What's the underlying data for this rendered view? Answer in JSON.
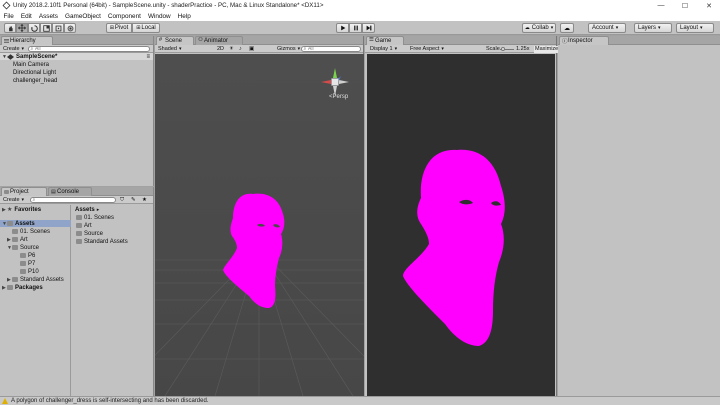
{
  "window": {
    "title": "Unity 2018.2.10f1 Personal (64bit) - SampleScene.unity - shaderPractice - PC, Mac & Linux Standalone* <DX11>",
    "minimize": "—",
    "maximize": "☐",
    "close": "✕"
  },
  "menu": [
    "File",
    "Edit",
    "Assets",
    "GameObject",
    "Component",
    "Window",
    "Help"
  ],
  "toolbar": {
    "pivot": "Pivot",
    "local": "Local",
    "collab": "Collab",
    "account": "Account",
    "layers": "Layers",
    "layout": "Layout"
  },
  "hierarchy": {
    "tab": "Hierarchy",
    "create": "Create",
    "search_placeholder": "All",
    "scene": "SampleScene*",
    "items": [
      "Main Camera",
      "Directional Light",
      "challenger_head"
    ]
  },
  "scene_view": {
    "tab_scene": "Scene",
    "tab_animator": "Animator",
    "shading": "Shaded",
    "mode_2d": "2D",
    "gizmos": "Gizmos",
    "search_placeholder": "All",
    "persp": "Persp"
  },
  "game_view": {
    "tab": "Game",
    "display": "Display 1",
    "aspect": "Free Aspect",
    "scale_label": "Scale",
    "scale_value": "1.25x",
    "maximize": "Maximize"
  },
  "inspector": {
    "tab": "Inspector"
  },
  "project": {
    "tab_project": "Project",
    "tab_console": "Console",
    "create": "Create",
    "favorites": "Favorites",
    "assets_root": "Assets",
    "tree": [
      "01. Scenes",
      "Art",
      "Source",
      "P6",
      "P7",
      "P10",
      "Standard Assets"
    ],
    "packages": "Packages",
    "breadcrumb": "Assets",
    "contents": [
      "01. Scenes",
      "Art",
      "Source",
      "Standard Assets"
    ]
  },
  "status": {
    "message": "A polygon of challenger_dress is self-intersecting and has been discarded."
  },
  "colors": {
    "magenta": "#ff00ff",
    "scene_bg": "#4a4a4a",
    "game_bg": "#2f2f2f",
    "selection": "#8fa4c8"
  }
}
